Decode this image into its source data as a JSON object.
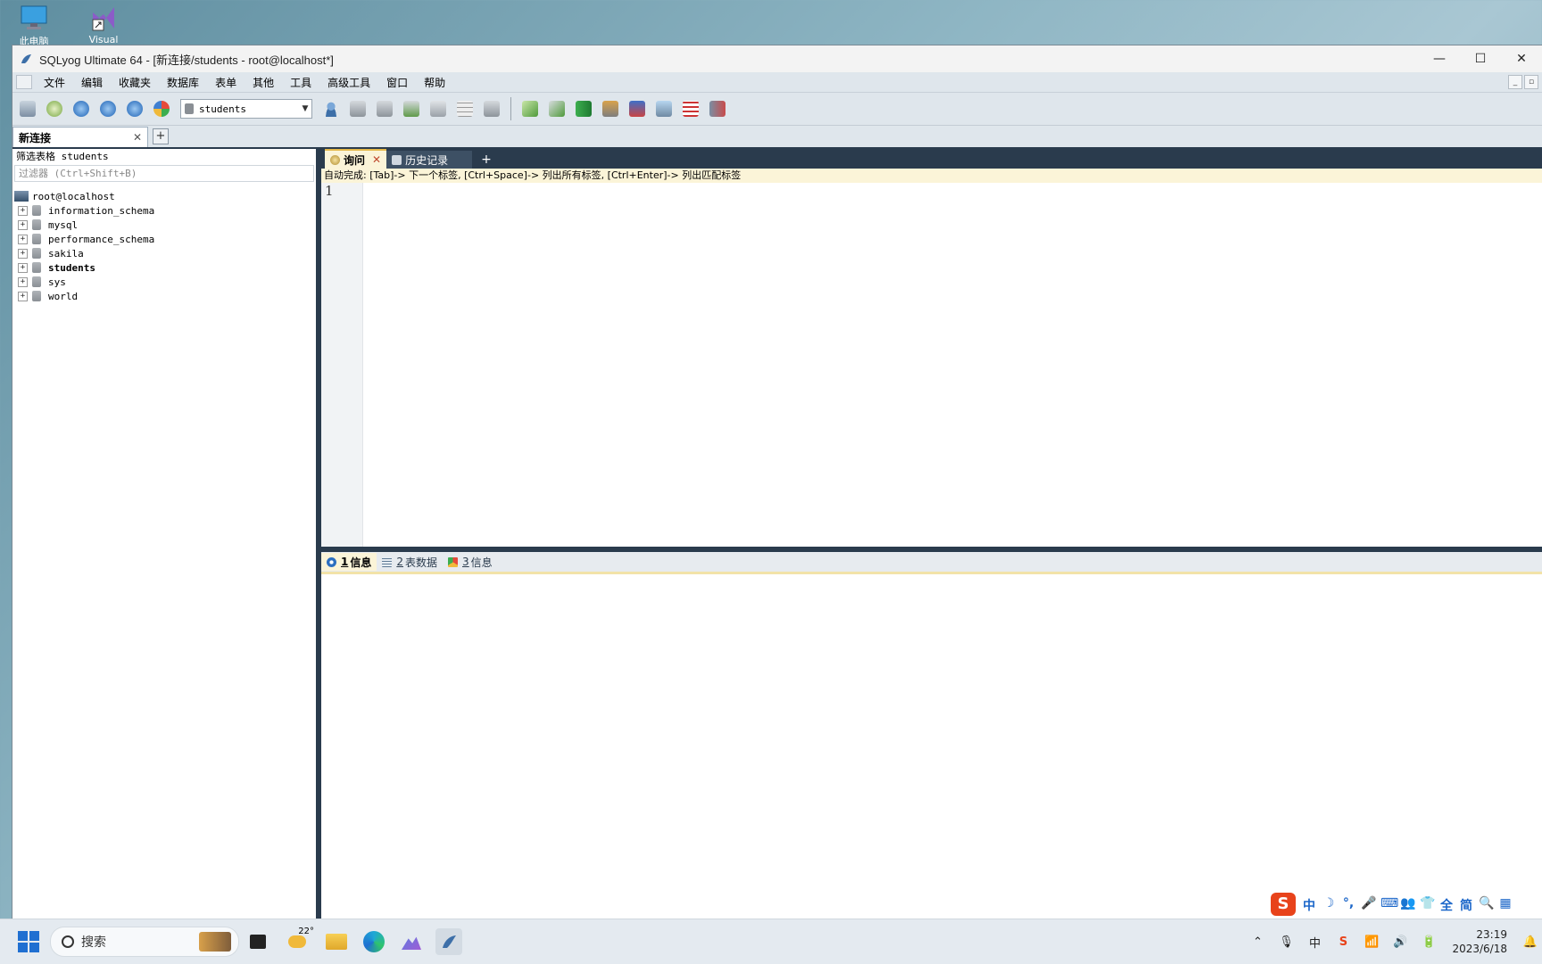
{
  "desktop": {
    "icons": [
      {
        "label": "此电脑",
        "icon": "monitor-icon"
      },
      {
        "label": "Visual",
        "icon": "visual-studio-icon"
      }
    ]
  },
  "window": {
    "title": "SQLyog Ultimate 64 - [新连接/students - root@localhost*]",
    "controls": {
      "minimize": "—",
      "maximize": "☐",
      "close": "✕"
    }
  },
  "menu": {
    "items": [
      "文件",
      "编辑",
      "收藏夹",
      "数据库",
      "表单",
      "其他",
      "工具",
      "高级工具",
      "窗口",
      "帮助"
    ]
  },
  "toolbar": {
    "db_selector": {
      "value": "students"
    }
  },
  "connection_tab": {
    "label": "新连接",
    "close": "✕",
    "add": "+"
  },
  "object_browser": {
    "header": "筛选表格 students",
    "filter_placeholder": "过滤器 (Ctrl+Shift+B)",
    "root": "root@localhost",
    "databases": [
      {
        "name": "information_schema",
        "bold": false
      },
      {
        "name": "mysql",
        "bold": false
      },
      {
        "name": "performance_schema",
        "bold": false
      },
      {
        "name": "sakila",
        "bold": false
      },
      {
        "name": "students",
        "bold": true
      },
      {
        "name": "sys",
        "bold": false
      },
      {
        "name": "world",
        "bold": false
      }
    ]
  },
  "query_tabs": {
    "tabs": [
      {
        "label": "询问",
        "active": true
      },
      {
        "label": "历史记录",
        "active": false
      }
    ],
    "close": "✕",
    "add": "+"
  },
  "editor": {
    "hint": "自动完成: [Tab]-> 下一个标签, [Ctrl+Space]-> 列出所有标签, [Ctrl+Enter]-> 列出匹配标签",
    "line_numbers": [
      "1"
    ]
  },
  "result_tabs": {
    "tabs": [
      {
        "num": "1",
        "label": "信息",
        "active": true
      },
      {
        "num": "2",
        "label": "表数据",
        "active": false
      },
      {
        "num": "3",
        "label": "信息",
        "active": false
      }
    ]
  },
  "ime": {
    "keys": [
      "中",
      "☽",
      "°,",
      "🎤",
      "⌨",
      "👥",
      "👕",
      "全",
      "简",
      "🔍",
      "▦"
    ]
  },
  "taskbar": {
    "search_placeholder": "搜索",
    "weather": "22°",
    "clock": {
      "time": "23:19",
      "date": "2023/6/18"
    }
  },
  "colors": {
    "dark_frame": "#2a3b4d",
    "hint_bg": "#fbf4d8",
    "windows_blue": "#1f6fd1",
    "sogou_red": "#e8431b"
  }
}
